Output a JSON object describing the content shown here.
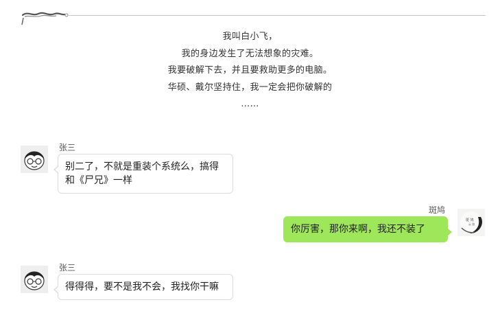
{
  "intro": {
    "lines": [
      "我叫白小飞，",
      "我的身边发生了无法想象的灾难。",
      "我要破解下去，并且要救助更多的电脑。",
      "华硕、戴尔坚持住，我一定会把你破解的",
      "……"
    ]
  },
  "messages": [
    {
      "sender": "张三",
      "text": "别二了，不就是重装个系统么，搞得和《尸兄》一样",
      "side": "left"
    },
    {
      "sender": "斑鸠",
      "text": "你厉害，那你来啊，我还不装了",
      "side": "right"
    },
    {
      "sender": "张三",
      "text": "得得得，要不是我不会，我找你干嘛",
      "side": "left"
    }
  ],
  "theme": {
    "outgoing_bubble": "#9ee65a",
    "incoming_bubble": "#ffffff",
    "incoming_border": "#dcdcdc"
  },
  "icons": {
    "header": "ink-ornament-icon",
    "avatar_left": "cartoon-boy-avatar",
    "avatar_right": "ink-moon-avatar"
  }
}
